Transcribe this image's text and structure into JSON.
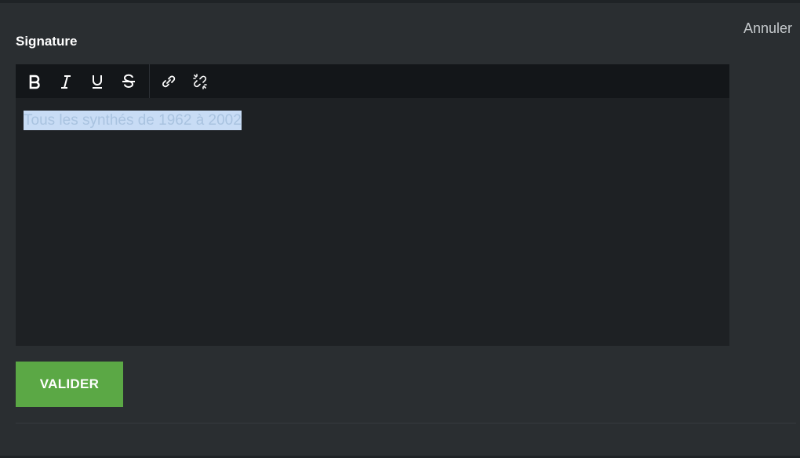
{
  "section": {
    "title": "Signature",
    "cancel_label": "Annuler"
  },
  "toolbar": {
    "buttons": [
      {
        "icon": "bold-icon"
      },
      {
        "icon": "italic-icon"
      },
      {
        "icon": "underline-icon"
      },
      {
        "icon": "strikethrough-icon"
      },
      {
        "icon": "link-icon"
      },
      {
        "icon": "unlink-icon"
      }
    ]
  },
  "editor": {
    "content": "Tous les synthés de 1962 à 2002",
    "selected": true
  },
  "actions": {
    "submit_label": "VALIDER"
  },
  "colors": {
    "background": "#2a2e31",
    "editor_bg": "#1e2124",
    "toolbar_bg": "#131619",
    "submit_bg": "#5ba845",
    "selection": "#c8dcf5"
  }
}
